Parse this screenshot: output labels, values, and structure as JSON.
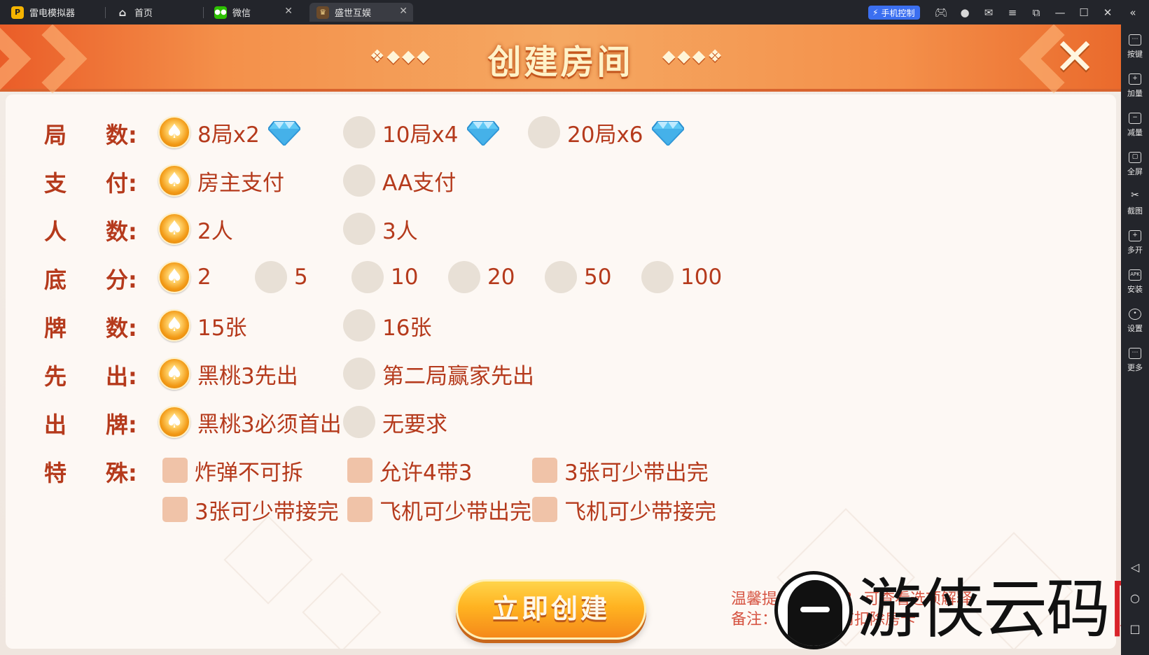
{
  "titlebar": {
    "app_name": "雷电模拟器",
    "tabs": [
      {
        "label": "首页",
        "icon": "home-icon"
      },
      {
        "label": "微信",
        "icon": "wechat-icon"
      },
      {
        "label": "盛世互娱",
        "icon": "game-app-icon"
      }
    ],
    "phone_control_label": "手机控制"
  },
  "sidebar": {
    "items": [
      {
        "label": "按键",
        "icon": "keyboard-icon"
      },
      {
        "label": "加量",
        "icon": "volume-up-icon"
      },
      {
        "label": "减量",
        "icon": "volume-down-icon"
      },
      {
        "label": "全屏",
        "icon": "fullscreen-icon"
      },
      {
        "label": "截图",
        "icon": "scissors-icon"
      },
      {
        "label": "多开",
        "icon": "multi-instance-icon"
      },
      {
        "label": "安装",
        "icon": "apk-install-icon"
      },
      {
        "label": "设置",
        "icon": "settings-icon"
      },
      {
        "label": "更多",
        "icon": "more-icon"
      }
    ],
    "nav": [
      "back-icon",
      "home-circle-icon",
      "recent-square-icon"
    ]
  },
  "dialog": {
    "title": "创建房间",
    "deco_left": "❖◆◆◆",
    "deco_right": "◆◆◆❖",
    "rows": [
      {
        "label1": "局",
        "label2": "数:",
        "options": [
          {
            "text": "8局x2",
            "selected": true,
            "gem": true
          },
          {
            "text": "10局x4",
            "selected": false,
            "gem": true
          },
          {
            "text": "20局x6",
            "selected": false,
            "gem": true
          }
        ]
      },
      {
        "label1": "支",
        "label2": "付:",
        "options": [
          {
            "text": "房主支付",
            "selected": true
          },
          {
            "text": "AA支付",
            "selected": false
          }
        ]
      },
      {
        "label1": "人",
        "label2": "数:",
        "options": [
          {
            "text": "2人",
            "selected": true
          },
          {
            "text": "3人",
            "selected": false
          }
        ]
      },
      {
        "label1": "底",
        "label2": "分:",
        "options": [
          {
            "text": "2",
            "selected": true
          },
          {
            "text": "5",
            "selected": false
          },
          {
            "text": "10",
            "selected": false
          },
          {
            "text": "20",
            "selected": false
          },
          {
            "text": "50",
            "selected": false
          },
          {
            "text": "100",
            "selected": false
          }
        ]
      },
      {
        "label1": "牌",
        "label2": "数:",
        "options": [
          {
            "text": "15张",
            "selected": true
          },
          {
            "text": "16张",
            "selected": false
          }
        ]
      },
      {
        "label1": "先",
        "label2": "出:",
        "options": [
          {
            "text": "黑桃3先出",
            "selected": true
          },
          {
            "text": "第二局赢家先出",
            "selected": false
          }
        ]
      },
      {
        "label1": "出",
        "label2": "牌:",
        "options": [
          {
            "text": "黑桃3必须首出",
            "selected": true
          },
          {
            "text": "无要求",
            "selected": false
          }
        ]
      },
      {
        "label1": "特",
        "label2": "殊:",
        "checkboxes": [
          {
            "text": "炸弹不可拆",
            "checked": false
          },
          {
            "text": "允许4带3",
            "checked": false
          },
          {
            "text": "3张可少带出完",
            "checked": false
          },
          {
            "text": "3张可少带接完",
            "checked": false
          },
          {
            "text": "飞机可少带出完",
            "checked": false
          },
          {
            "text": "飞机可少带接完",
            "checked": false
          }
        ]
      }
    ],
    "create_button": "立即创建",
    "tip_line1": "温馨提示：点击 ？ 可查看选项解释",
    "tip_line2": "备注：首局计算前扣除房卡"
  },
  "watermark": {
    "text_main": "游侠云码",
    "text_accent": "网"
  },
  "colors": {
    "accent_orange": "#f4904a",
    "label_red": "#b53a1c",
    "tip_red": "#d65442"
  }
}
